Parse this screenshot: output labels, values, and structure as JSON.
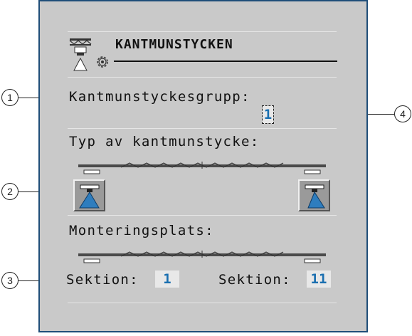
{
  "title": "KANTMUNSTYCKEN",
  "group": {
    "label": "Kantmunstyckesgrupp:",
    "value": "1"
  },
  "type": {
    "label": "Typ av kantmunstycke:"
  },
  "mounting": {
    "label": "Monteringsplats:",
    "left_label": "Sektion:",
    "left_value": "1",
    "right_label": "Sektion:",
    "right_value": "11"
  },
  "callouts": [
    "1",
    "2",
    "3",
    "4"
  ],
  "colors": {
    "frame": "#1f4e79",
    "panel": "#c9c9c9",
    "value": "#1a6fb0",
    "nozzle": "#2e7dbe"
  },
  "icons": [
    "sprayer-boom-icon",
    "settings-gear-icon",
    "edge-nozzle-left-icon",
    "edge-nozzle-right-icon",
    "boom-frame-icon"
  ]
}
